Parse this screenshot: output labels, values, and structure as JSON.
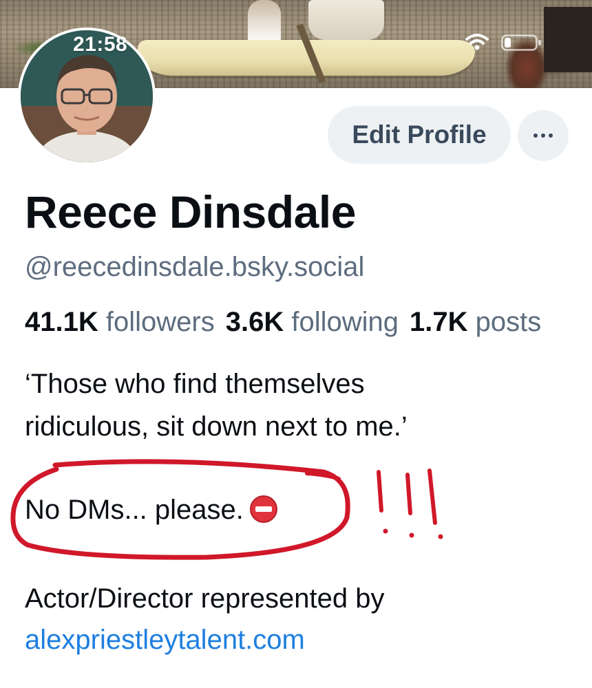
{
  "status_bar": {
    "time": "21:58"
  },
  "profile": {
    "display_name": "Reece Dinsdale",
    "handle": "@reecedinsdale.bsky.social",
    "stats": {
      "followers_count": "41.1K",
      "followers_label": "followers",
      "following_count": "3.6K",
      "following_label": "following",
      "posts_count": "1.7K",
      "posts_label": "posts"
    },
    "bio": {
      "line1": "‘Those who find themselves",
      "line2": "ridiculous, sit down next to me.’",
      "line3": "No DMs... please.",
      "line4": "Actor/Director represented by",
      "link": "alexpriestleytalent.com"
    }
  },
  "actions": {
    "edit_profile_label": "Edit Profile",
    "more_label": "···"
  },
  "colors": {
    "accent_link": "#1d7fe0",
    "muted_text": "#5d6c7e",
    "button_bg": "#eef1f4",
    "annotation_red": "#d0182a"
  },
  "icons": {
    "wifi": "wifi-icon",
    "battery": "battery-icon",
    "more": "ellipsis-icon",
    "no_entry": "no-entry-emoji-icon"
  }
}
